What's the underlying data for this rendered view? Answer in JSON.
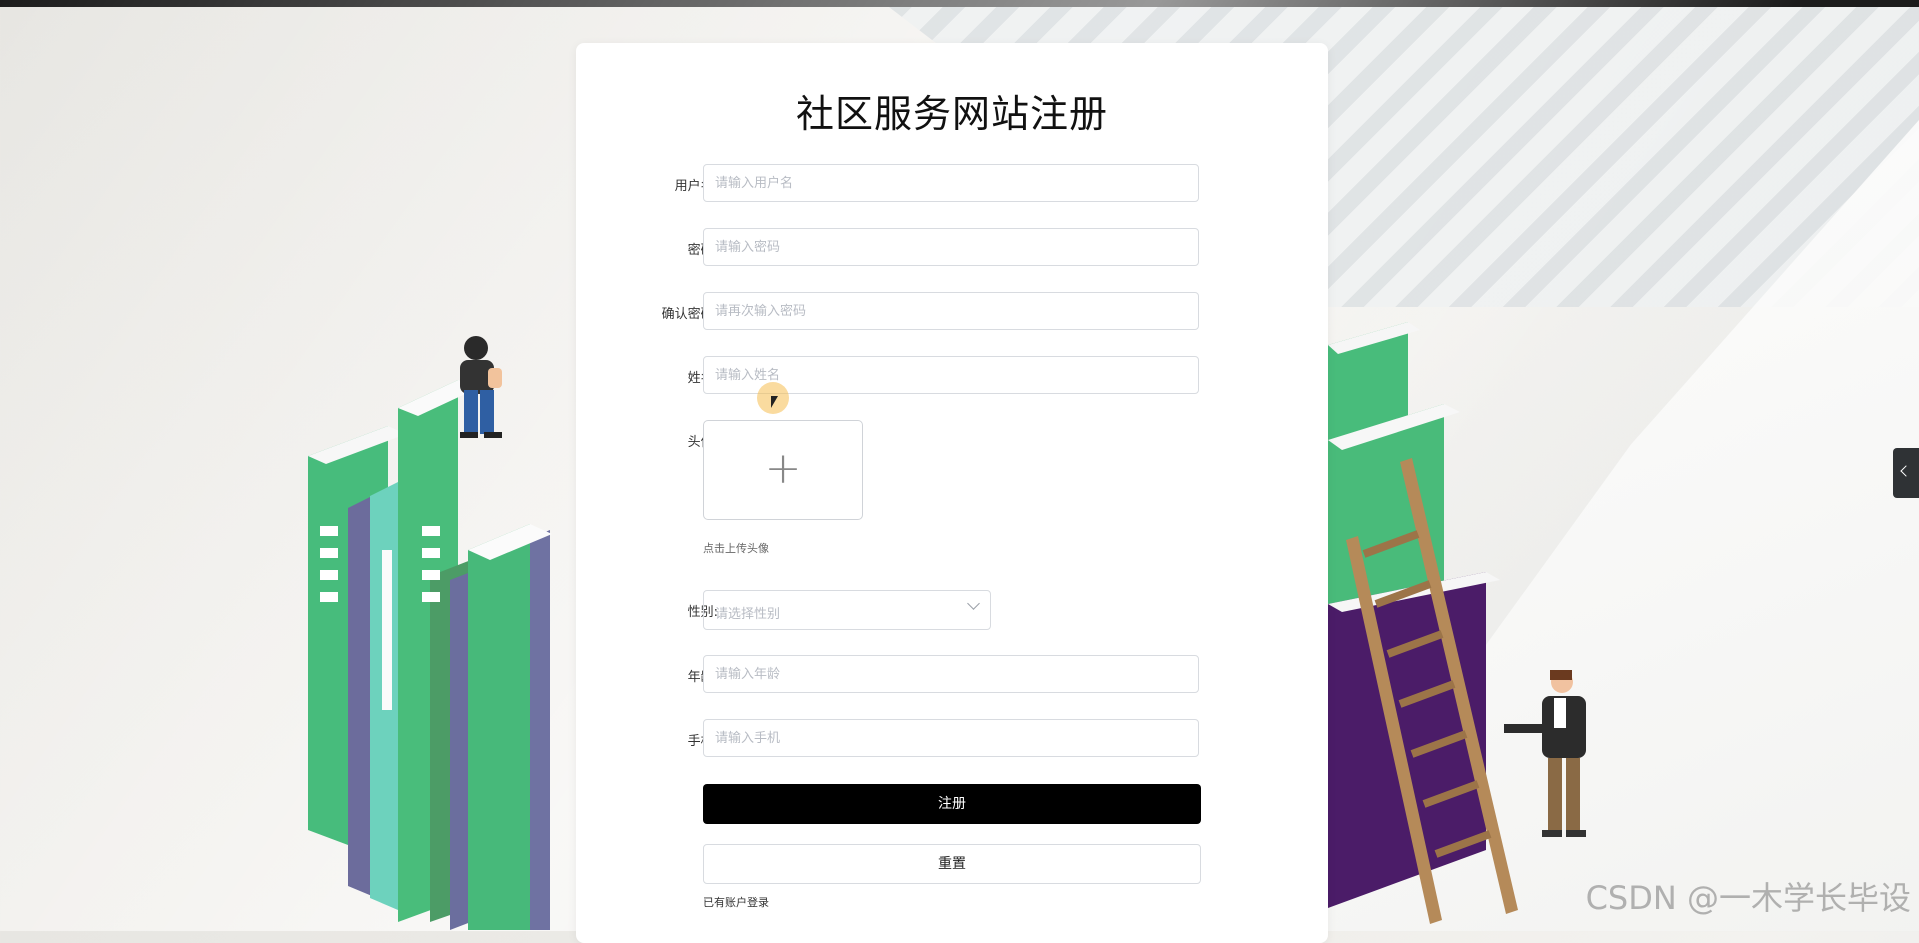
{
  "form": {
    "title": "社区服务网站注册",
    "fields": {
      "username": {
        "label": "用户名:",
        "placeholder": "请输入用户名"
      },
      "password": {
        "label": "密码:",
        "placeholder": "请输入密码"
      },
      "confirm": {
        "label": "确认密码:",
        "placeholder": "请再次输入密码"
      },
      "name": {
        "label": "姓名:",
        "placeholder": "请输入姓名"
      },
      "avatar": {
        "label": "头像:",
        "hint": "点击上传头像"
      },
      "gender": {
        "label": "性别:",
        "placeholder": "请选择性别"
      },
      "age": {
        "label": "年龄:",
        "placeholder": "请输入年龄"
      },
      "phone": {
        "label": "手机:",
        "placeholder": "请输入手机"
      }
    },
    "buttons": {
      "register": "注册",
      "reset": "重置"
    },
    "login_link": "已有账户登录"
  },
  "watermark": "CSDN @一木学长毕设",
  "colors": {
    "primary_button": "#000000",
    "book_green": "#43b877",
    "book_purple": "#6f6f9e",
    "book_teal": "#6fd3c0"
  },
  "icons": {
    "upload": "plus-icon",
    "select": "chevron-down-icon",
    "side_tab": "chevron-left-icon"
  }
}
